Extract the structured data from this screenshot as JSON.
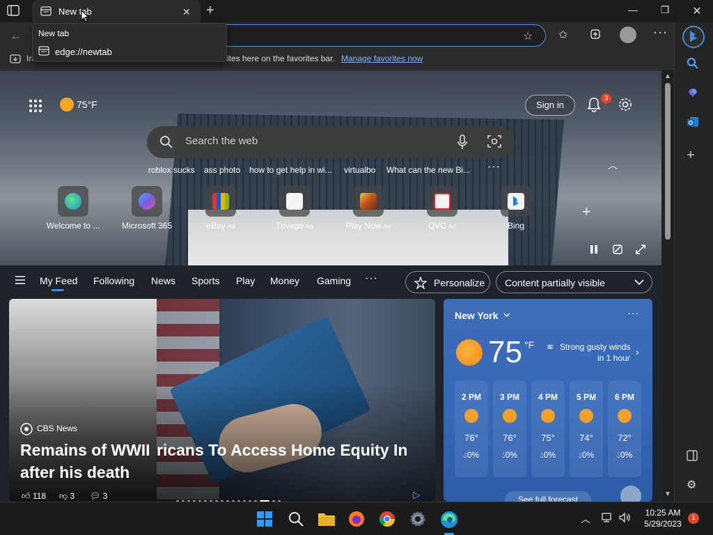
{
  "browser": {
    "tab_title": "New tab",
    "tooltip_title": "New tab",
    "tooltip_url": "edge://newtab",
    "favorites_bar_text_left": "Im",
    "favorites_bar_text_right": "ites here on the favorites bar.",
    "favorites_bar_link": "Manage favorites now"
  },
  "header": {
    "temperature": "75°F",
    "sign_in": "Sign in",
    "notification_count": "3"
  },
  "search": {
    "placeholder": "Search the web",
    "trending": [
      "roblox sucks",
      "ass photo",
      "how to get help in wi...",
      "virtualbo",
      "What can the new Bi..."
    ],
    "more": "···"
  },
  "quick_links": [
    {
      "label": "Welcome to ...",
      "ad": "",
      "color": "#1e90d8"
    },
    {
      "label": "Microsoft 365",
      "ad": "",
      "color": "#6f5ad8"
    },
    {
      "label": "eBay",
      "ad": "Ad",
      "color": "#e53238"
    },
    {
      "label": "Trivago",
      "ad": "Ad",
      "color": "#f4f4f4"
    },
    {
      "label": "Play Now",
      "ad": "Ad",
      "color": "#c0521a"
    },
    {
      "label": "QVC",
      "ad": "Ad",
      "color": "#f2f2f2"
    },
    {
      "label": "Bing",
      "ad": "",
      "color": "#f2f2f2"
    }
  ],
  "feed": {
    "tabs": [
      "My Feed",
      "Following",
      "News",
      "Sports",
      "Play",
      "Money",
      "Gaming"
    ],
    "more": "···",
    "personalize": "Personalize",
    "content_visibility": "Content partially visible"
  },
  "main_story": {
    "source": "CBS News",
    "headline_line1_left": "Remains of WWII",
    "headline_line2_left": "after his death",
    "headline_right": "ricans To Access Home Equity In",
    "likes": "118",
    "dislikes": "3",
    "comments": "3"
  },
  "weather": {
    "city": "New York",
    "temperature": "75",
    "unit": "°F",
    "alert_line1": "Strong gusty winds",
    "alert_line2": "in 1 hour",
    "hourly": [
      {
        "hour": "2 PM",
        "temp": "76°",
        "precip": "0%"
      },
      {
        "hour": "3 PM",
        "temp": "76°",
        "precip": "0%"
      },
      {
        "hour": "4 PM",
        "temp": "75°",
        "precip": "0%"
      },
      {
        "hour": "5 PM",
        "temp": "74°",
        "precip": "0%"
      },
      {
        "hour": "6 PM",
        "temp": "72°",
        "precip": "0%"
      }
    ],
    "forecast_link": "See full forecast"
  },
  "taskbar": {
    "time": "10:25 AM",
    "date": "5/29/2023",
    "notification_count": "1"
  },
  "colors": {
    "accent": "#3b8eea",
    "weather_card": "#3568b8",
    "badge": "#e8412d"
  }
}
